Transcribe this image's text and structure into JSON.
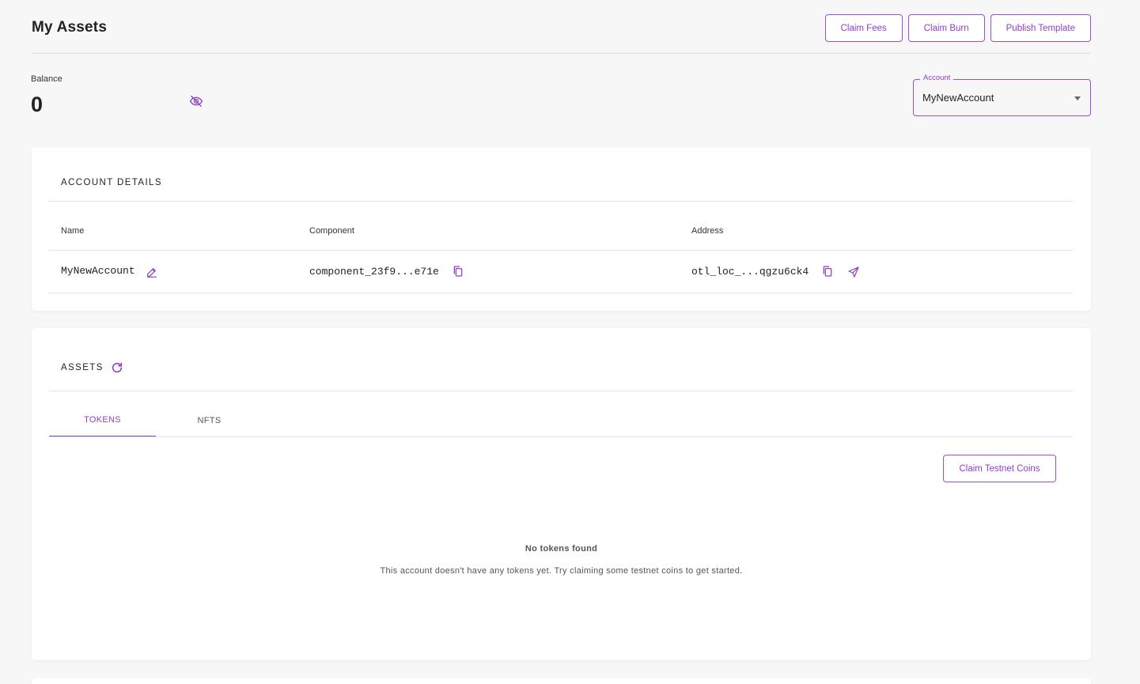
{
  "header": {
    "title": "My Assets",
    "actions": [
      "Claim Fees",
      "Claim Burn",
      "Publish Template"
    ]
  },
  "balance": {
    "label": "Balance",
    "value": "0",
    "visibility_icon": "eye-off-icon"
  },
  "account_select": {
    "label": "Account",
    "value": "MyNewAccount"
  },
  "account_details": {
    "title": "ACCOUNT DETAILS",
    "columns": [
      "Name",
      "Component",
      "Address"
    ],
    "row": {
      "name": "MyNewAccount",
      "component": "component_23f9...e71e",
      "address": "otl_loc_...qgzu6ck4"
    }
  },
  "assets": {
    "title": "ASSETS",
    "tabs": [
      "TOKENS",
      "NFTS"
    ],
    "active_tab": "TOKENS",
    "claim_button": "Claim Testnet Coins",
    "empty_title": "No tokens found",
    "empty_text": "This account doesn't have any tokens yet. Try claiming some testnet coins to get started."
  },
  "colors": {
    "accent": "#8e3fc8",
    "background": "#f7f7f7",
    "card": "#ffffff"
  }
}
